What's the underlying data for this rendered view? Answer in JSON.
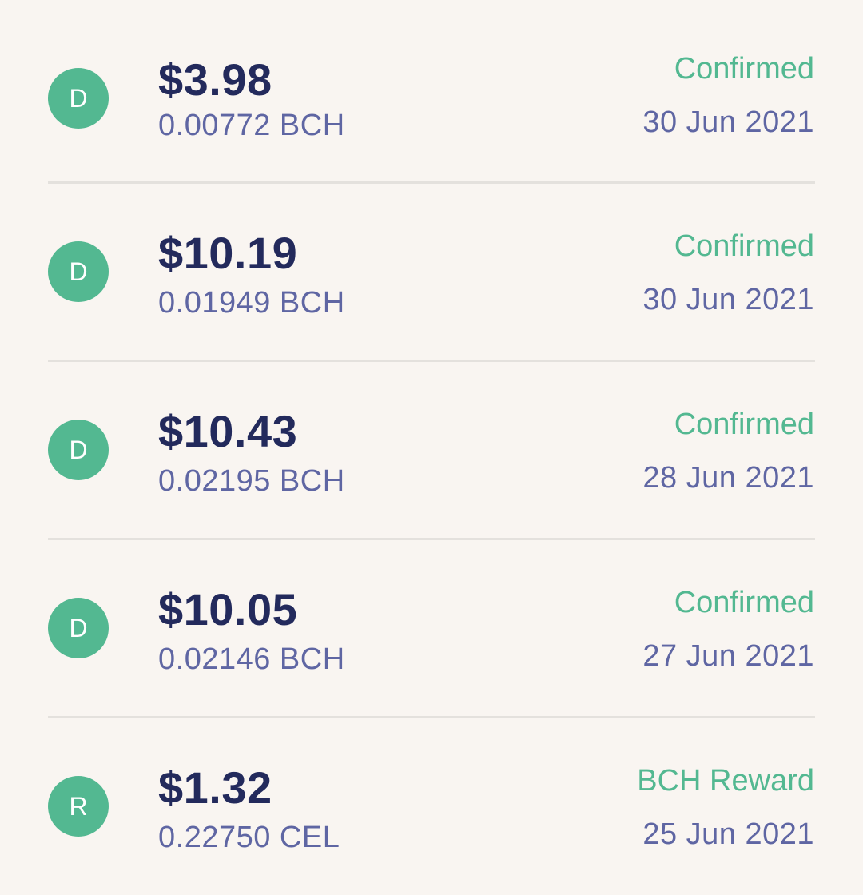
{
  "transactions": [
    {
      "avatar_letter": "D",
      "fiat_amount": "$3.98",
      "crypto_amount": "0.00772 BCH",
      "status": "Confirmed",
      "date": "30 Jun 2021"
    },
    {
      "avatar_letter": "D",
      "fiat_amount": "$10.19",
      "crypto_amount": "0.01949 BCH",
      "status": "Confirmed",
      "date": "30 Jun 2021"
    },
    {
      "avatar_letter": "D",
      "fiat_amount": "$10.43",
      "crypto_amount": "0.02195 BCH",
      "status": "Confirmed",
      "date": "28 Jun 2021"
    },
    {
      "avatar_letter": "D",
      "fiat_amount": "$10.05",
      "crypto_amount": "0.02146 BCH",
      "status": "Confirmed",
      "date": "27 Jun 2021"
    },
    {
      "avatar_letter": "R",
      "fiat_amount": "$1.32",
      "crypto_amount": "0.22750 CEL",
      "status": "BCH Reward",
      "date": "25 Jun 2021"
    }
  ],
  "colors": {
    "background": "#f9f5f1",
    "accent_green": "#53b891",
    "amount_navy": "#232a5c",
    "secondary_purple": "#5f66a3",
    "divider": "#e4e1dd"
  }
}
